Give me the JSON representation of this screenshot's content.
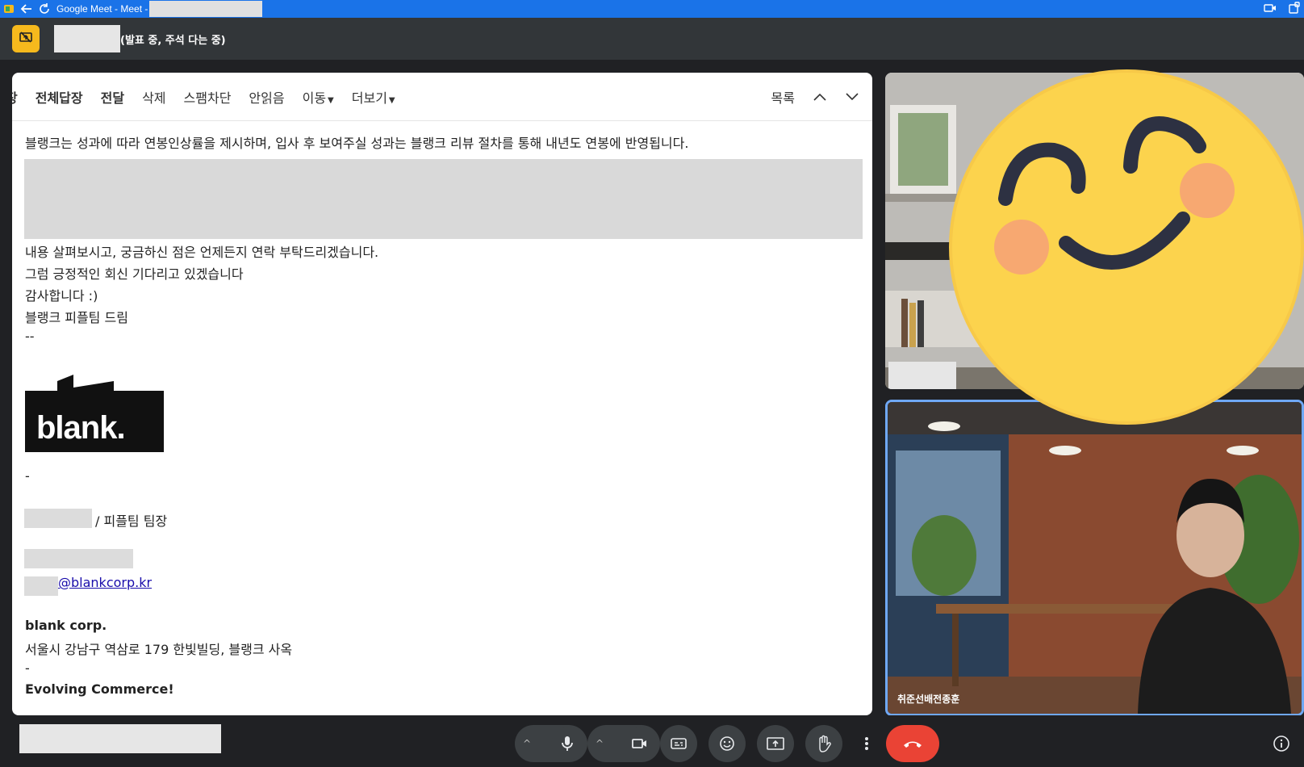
{
  "browser": {
    "tab_title": "Google Meet - Meet -"
  },
  "presenter_bar": {
    "status": "(발표 중, 주석 다는 중)"
  },
  "mail_toolbar": {
    "reply": "장",
    "reply_all": "전체답장",
    "forward": "전달",
    "delete": "삭제",
    "block_spam": "스팸차단",
    "unread": "안읽음",
    "move": "이동",
    "more": "더보기",
    "list": "목록"
  },
  "mail": {
    "line1": "블랭크는 성과에 따라 연봉인상률을 제시하며, 입사 후 보여주실 성과는 블랭크 리뷰 절차를 통해 내년도 연봉에 반영됩니다.",
    "line2": "내용 살펴보시고, 궁금하신 점은 언제든지 연락 부탁드리겠습니다.",
    "line3": "그럼 긍정적인 회신 기다리고 있겠습니다",
    "line4": "감사합니다 :)",
    "line5": "블랭크 피플팀 드림",
    "sep1": "--",
    "logo_text": "blank.",
    "sep2": "-",
    "signature_title": "/ 피플팀 팀장",
    "email_domain": "@blankcorp.kr",
    "company": "blank corp.",
    "address": "서울시 강남구 역삼로 179 한빛빌딩, 블랭크 사옥",
    "sep3": "-",
    "slogan": "Evolving Commerce!"
  },
  "participants": {
    "tile2_name": "취준선배전종훈"
  },
  "colors": {
    "chrome_blue": "#1a73e8",
    "meet_bg": "#202124",
    "control_bg": "#3c4043",
    "end_call_red": "#ea4335",
    "badge_yellow": "#f6b91d",
    "active_border": "#6fa8f5"
  },
  "icons": {
    "chrome": [
      "site-favicon-icon",
      "back-arrow-icon",
      "reload-icon",
      "camera-indicator-icon",
      "extension-icon"
    ],
    "controls": [
      "chevron-up-icon",
      "microphone-icon",
      "camera-icon",
      "captions-icon",
      "emoji-icon",
      "present-icon",
      "raise-hand-icon",
      "more-options-icon",
      "end-call-icon",
      "info-icon"
    ]
  }
}
